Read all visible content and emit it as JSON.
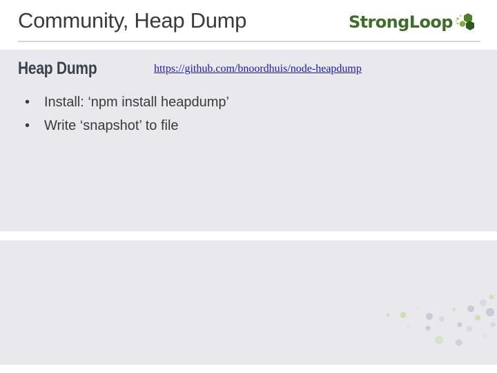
{
  "slide": {
    "title": "Community, Heap Dump",
    "logo_text": "StrongLoop",
    "heading": "Heap Dump",
    "link": "https://github.com/bnoordhuis/node-heapdump",
    "bullets": [
      "Install: ‘npm install heapdump’",
      "Write ‘snapshot’ to file"
    ],
    "bullet_symbol": "•"
  },
  "colors": {
    "brand_green": "#3e6e29",
    "panel_bg": "#e9e8ed",
    "link": "#1a1ab0",
    "heading": "#3a4148"
  },
  "icons": {
    "logo_mark": "hexagon-cluster-icon",
    "decoration": "hexagon-dots-icon"
  }
}
